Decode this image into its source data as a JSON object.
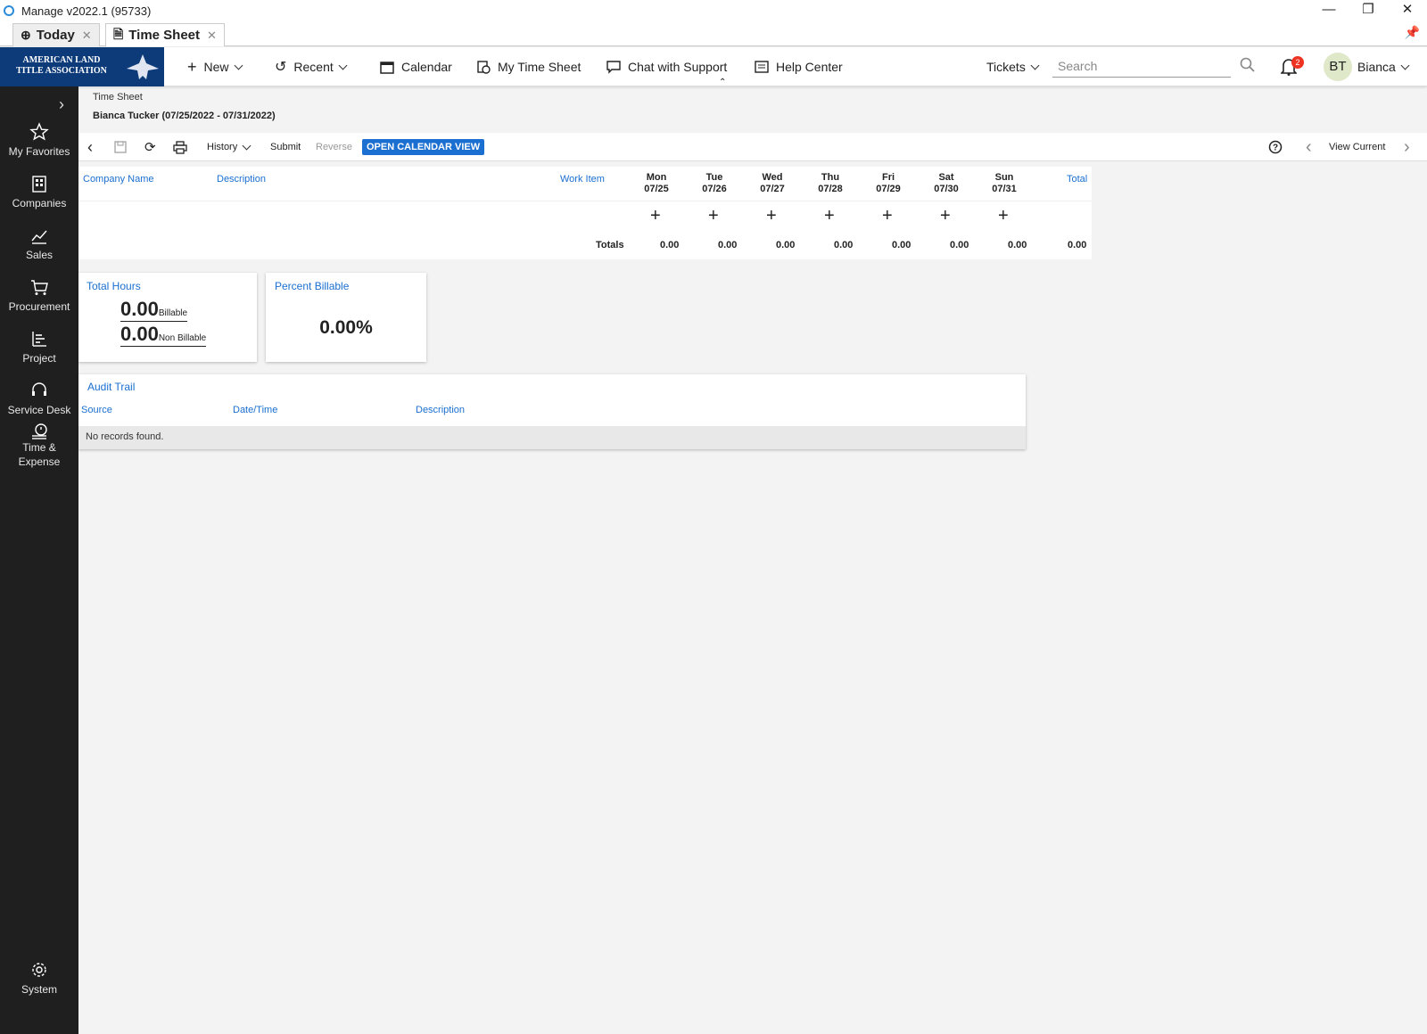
{
  "window": {
    "title": "Manage v2022.1 (95733)"
  },
  "tabs": [
    {
      "label": "Today"
    },
    {
      "label": "Time Sheet"
    }
  ],
  "logo": {
    "text": "AMERICAN LAND TITLE ASSOCIATION"
  },
  "nav": {
    "new": "New",
    "recent": "Recent",
    "calendar": "Calendar",
    "my_time_sheet": "My Time Sheet",
    "chat": "Chat with Support",
    "help": "Help Center",
    "tickets": "Tickets",
    "search_placeholder": "Search",
    "notifications": "2",
    "avatar_initials": "BT",
    "user": "Bianca"
  },
  "sidebar": {
    "items": [
      {
        "label": "My Favorites"
      },
      {
        "label": "Companies"
      },
      {
        "label": "Sales"
      },
      {
        "label": "Procurement"
      },
      {
        "label": "Project"
      },
      {
        "label": "Service Desk"
      },
      {
        "label": "Time &"
      },
      {
        "label": "Expense"
      },
      {
        "label": "System"
      }
    ]
  },
  "page": {
    "breadcrumb": "Time Sheet",
    "subtitle": "Bianca Tucker (07/25/2022 - 07/31/2022)"
  },
  "toolbar": {
    "history": "History",
    "submit": "Submit",
    "reverse": "Reverse",
    "open_calendar": "OPEN CALENDAR VIEW",
    "view_current": "View Current"
  },
  "grid": {
    "headers": {
      "company": "Company Name",
      "description": "Description",
      "work_item": "Work Item",
      "total": "Total"
    },
    "days": [
      {
        "name": "Mon",
        "date": "07/25",
        "total": "0.00"
      },
      {
        "name": "Tue",
        "date": "07/26",
        "total": "0.00"
      },
      {
        "name": "Wed",
        "date": "07/27",
        "total": "0.00"
      },
      {
        "name": "Thu",
        "date": "07/28",
        "total": "0.00"
      },
      {
        "name": "Fri",
        "date": "07/29",
        "total": "0.00"
      },
      {
        "name": "Sat",
        "date": "07/30",
        "total": "0.00"
      },
      {
        "name": "Sun",
        "date": "07/31",
        "total": "0.00"
      }
    ],
    "totals_label": "Totals",
    "grand_total": "0.00"
  },
  "cards": {
    "total_hours": {
      "title": "Total Hours",
      "billable": "0.00",
      "billable_label": "Billable",
      "non_billable": "0.00",
      "non_billable_label": "Non Billable"
    },
    "percent_billable": {
      "title": "Percent Billable",
      "value": "0.00%"
    }
  },
  "audit": {
    "title": "Audit Trail",
    "columns": [
      "Source",
      "Date/Time",
      "Description"
    ],
    "empty": "No records found."
  }
}
